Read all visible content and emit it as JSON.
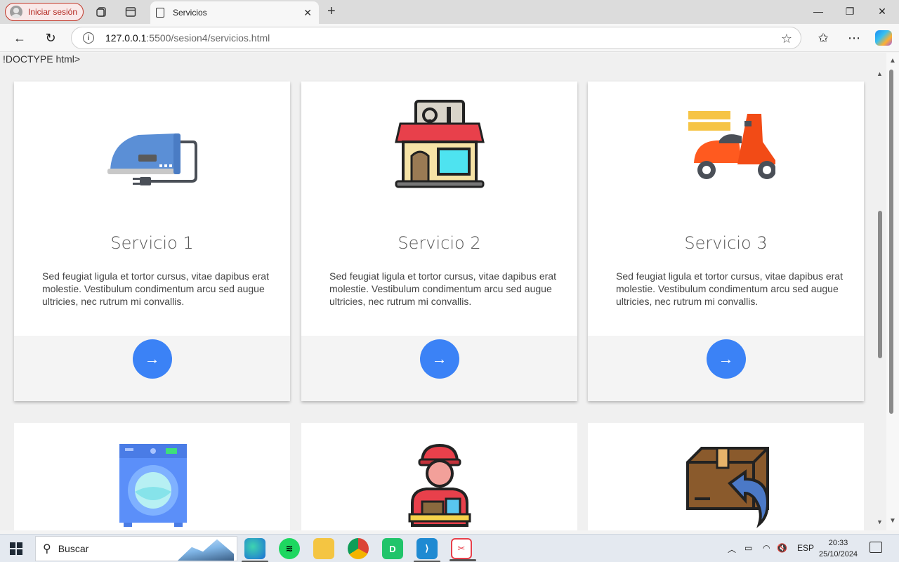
{
  "browser": {
    "profile_label": "Iniciar sesión",
    "tab_title": "Servicios",
    "url_host": "127.0.0.1",
    "url_path": ":5500/sesion4/servicios.html"
  },
  "page": {
    "doctype_text": "!DOCTYPE html>",
    "services": [
      {
        "title": "Servicio 1",
        "text": "Sed feugiat ligula et tortor cursus, vitae dapibus erat molestie. Vestibulum condimentum arcu sed augue ultricies, nec rutrum mi convallis.",
        "icon": "iron-icon",
        "button": "→"
      },
      {
        "title": "Servicio 2",
        "text": "Sed feugiat ligula et tortor cursus, vitae dapibus erat molestie. Vestibulum condimentum arcu sed augue ultricies, nec rutrum mi convallis.",
        "icon": "repair-shop-icon",
        "button": "→"
      },
      {
        "title": "Servicio 3",
        "text": "Sed feugiat ligula et tortor cursus, vitae dapibus erat molestie. Vestibulum condimentum arcu sed augue ultricies, nec rutrum mi convallis.",
        "icon": "delivery-scooter-icon",
        "button": "→"
      }
    ],
    "second_row_icons": [
      "washing-machine-icon",
      "delivery-person-icon",
      "package-return-icon"
    ]
  },
  "taskbar": {
    "search_placeholder": "Buscar",
    "language": "ESP",
    "time": "20:33",
    "date": "25/10/2024"
  },
  "colors": {
    "accent_button": "#3b82f6",
    "profile_border": "#c0392b"
  }
}
